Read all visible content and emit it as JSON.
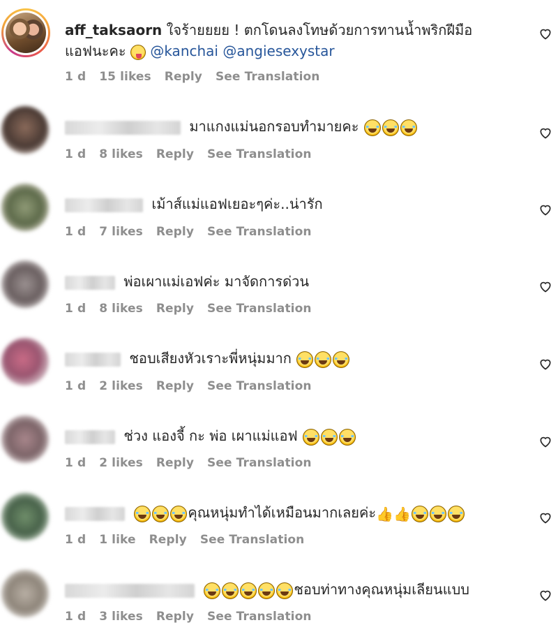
{
  "comments": [
    {
      "username": "aff_taksaorn",
      "text_line1": "ใจร้ายยยย ! ตกโดนลงโทษด้วยการทานน้ำพริกฝีมือ",
      "text_line2": "แอฟนะคะ",
      "mentions": "@kanchai @angiesexystar",
      "time": "1 d",
      "likes": "15 likes",
      "reply": "Reply",
      "translate": "See Translation"
    },
    {
      "text": "มาแกงแม่นอกรอบทำมายคะ",
      "time": "1 d",
      "likes": "8 likes",
      "reply": "Reply",
      "translate": "See Translation"
    },
    {
      "text": "เม้าส์แม่แอฟเยอะๆค่ะ..น่ารัก",
      "time": "1 d",
      "likes": "7 likes",
      "reply": "Reply",
      "translate": "See Translation"
    },
    {
      "text": "พ่อเผาแม่เอฟค่ะ มาจัดการด่วน",
      "time": "1 d",
      "likes": "8 likes",
      "reply": "Reply",
      "translate": "See Translation"
    },
    {
      "text": "ชอบเสียงหัวเราะพี่หนุ่มมาก",
      "time": "1 d",
      "likes": "2 likes",
      "reply": "Reply",
      "translate": "See Translation"
    },
    {
      "text": "ช่วง แองจี้ กะ พ่อ เผาแม่แอฟ",
      "time": "1 d",
      "likes": "2 likes",
      "reply": "Reply",
      "translate": "See Translation"
    },
    {
      "text": "คุณหนุ่มทำได้เหมือนมากเลยค่ะ",
      "time": "1 d",
      "likes": "1 like",
      "reply": "Reply",
      "translate": "See Translation"
    },
    {
      "text": "ชอบท่าทางคุณหนุ่มเลียนแบบ",
      "time": "1 d",
      "likes": "3 likes",
      "reply": "Reply",
      "translate": "See Translation"
    }
  ],
  "icons": {
    "like": "heart-outline-icon",
    "laugh": "tears-of-joy-emoji",
    "tongue": "winking-tongue-emoji",
    "thumbs": "thumbs-up-emoji"
  },
  "colors": {
    "text": "#262626",
    "meta": "#8e8e8e",
    "mention": "#27569a"
  }
}
